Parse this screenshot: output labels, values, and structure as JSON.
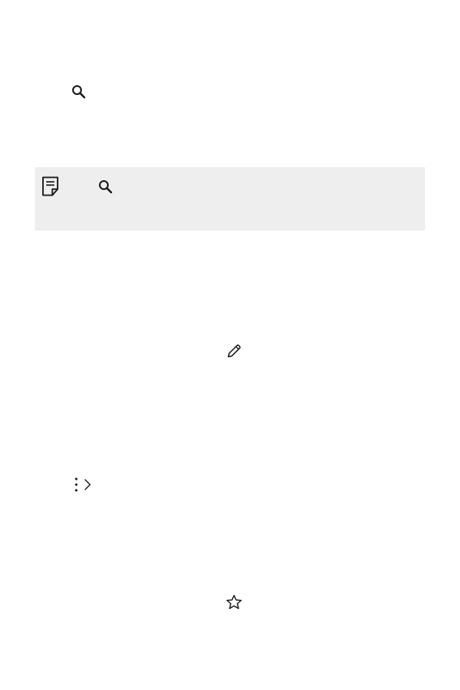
{
  "icons": {
    "search_top": "search-icon",
    "note": "note-icon",
    "search_note": "search-icon",
    "edit": "pencil-icon",
    "more": "more-vertical-icon",
    "chevron": "chevron-right-icon",
    "favorite": "star-icon"
  },
  "colors": {
    "icon": "#1a1a1a",
    "note_background": "#eeeeee"
  }
}
